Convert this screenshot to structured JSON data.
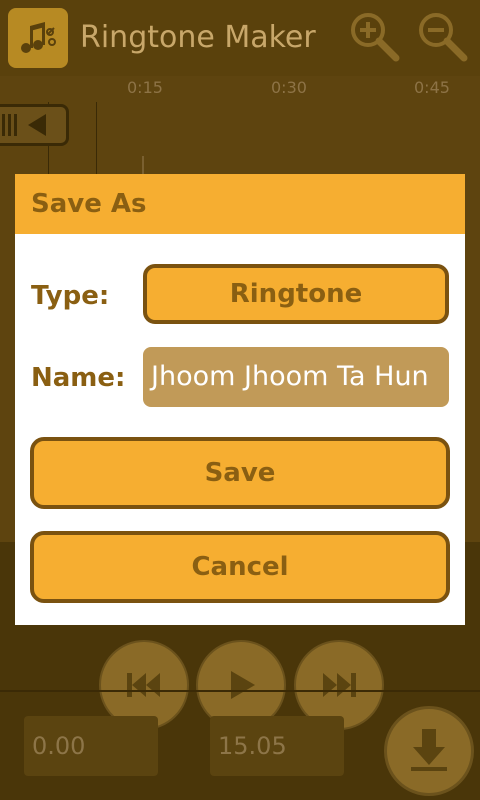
{
  "app": {
    "title": "Ringtone Maker",
    "icon": "ringtone-scissors-icon",
    "zoom_in_icon": "zoom-in-icon",
    "zoom_out_icon": "zoom-out-icon"
  },
  "waveform": {
    "ticks": [
      "0:15",
      "0:30",
      "0:45"
    ]
  },
  "controls": {
    "rewind_icon": "rewind-icon",
    "play_icon": "play-icon",
    "ffwd_icon": "fast-forward-icon",
    "start_time": "0.00",
    "end_time": "15.05",
    "save_icon": "download-icon"
  },
  "dialog": {
    "title": "Save As",
    "type_label": "Type:",
    "type_value": "Ringtone",
    "name_label": "Name:",
    "name_value": "Jhoom Jhoom Ta Hun",
    "save_label": "Save",
    "cancel_label": "Cancel"
  },
  "colors": {
    "accent": "#f6ae31",
    "accent_dark": "#8a5f12",
    "border": "#7a5210",
    "overlay_bg": "#4a3609"
  }
}
